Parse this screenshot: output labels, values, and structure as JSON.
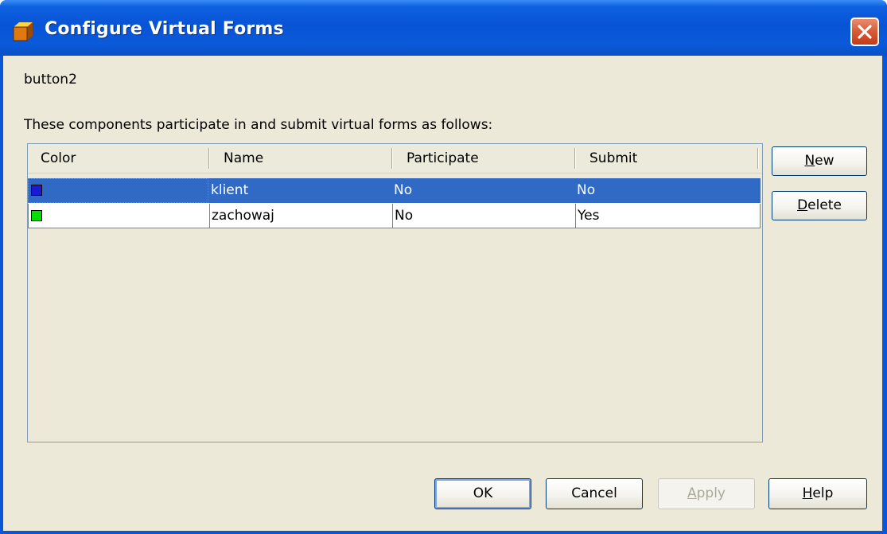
{
  "window": {
    "title": "Configure Virtual Forms",
    "icon": "app-cube-icon",
    "close_icon": "close-icon"
  },
  "component_label": "button2",
  "description": "These components participate in and submit virtual forms as follows:",
  "table": {
    "columns": [
      "Color",
      "Name",
      "Participate",
      "Submit"
    ],
    "rows": [
      {
        "color": "#1a1ad6",
        "name": "klient",
        "participate": "No",
        "submit": "No",
        "selected": true
      },
      {
        "color": "#00e000",
        "name": "zachowaj",
        "participate": "No",
        "submit": "Yes",
        "selected": false
      }
    ]
  },
  "side_buttons": {
    "new": {
      "mnemonic": "N",
      "rest": "ew"
    },
    "delete": {
      "mnemonic": "D",
      "rest": "elete"
    }
  },
  "footer_buttons": {
    "ok": "OK",
    "cancel": "Cancel",
    "apply": {
      "mnemonic": "A",
      "rest": "pply",
      "enabled": false
    },
    "help": {
      "mnemonic": "H",
      "rest": "elp"
    }
  },
  "colors": {
    "titlebar": "#0a56d8",
    "selection": "#316ac5",
    "dialog_bg": "#ece9d8"
  }
}
